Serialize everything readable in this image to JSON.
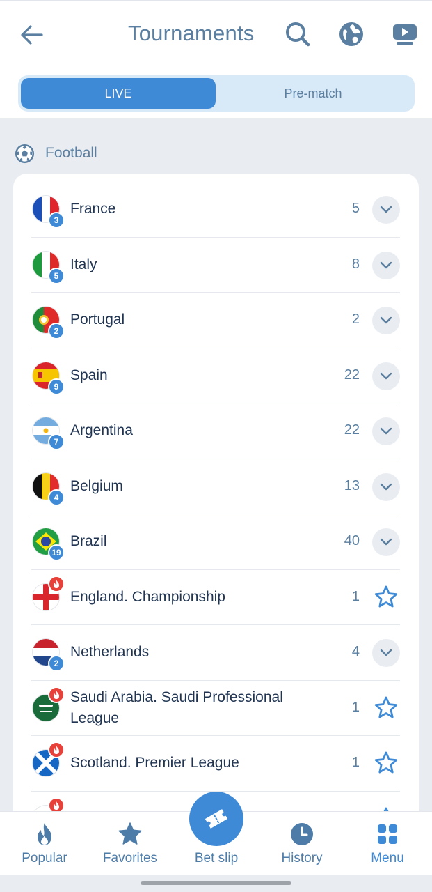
{
  "header": {
    "title": "Tournaments",
    "back_icon": "arrow-left-icon",
    "search_icon": "search-icon",
    "globe_icon": "globe-icon",
    "video_icon": "tv-play-icon"
  },
  "tabs": [
    {
      "label": "LIVE",
      "active": true
    },
    {
      "label": "Pre-match",
      "active": false
    }
  ],
  "section": {
    "icon": "football-icon",
    "label": "Football"
  },
  "tournaments": [
    {
      "name": "France",
      "count": "5",
      "badge": "3",
      "hot": false,
      "action": "expand"
    },
    {
      "name": "Italy",
      "count": "8",
      "badge": "5",
      "hot": false,
      "action": "expand"
    },
    {
      "name": "Portugal",
      "count": "2",
      "badge": "2",
      "hot": false,
      "action": "expand"
    },
    {
      "name": "Spain",
      "count": "22",
      "badge": "9",
      "hot": false,
      "action": "expand"
    },
    {
      "name": "Argentina",
      "count": "22",
      "badge": "7",
      "hot": false,
      "action": "expand"
    },
    {
      "name": "Belgium",
      "count": "13",
      "badge": "4",
      "hot": false,
      "action": "expand"
    },
    {
      "name": "Brazil",
      "count": "40",
      "badge": "19",
      "hot": false,
      "action": "expand"
    },
    {
      "name": "England. Championship",
      "count": "1",
      "badge": "",
      "hot": true,
      "action": "favorite"
    },
    {
      "name": "Netherlands",
      "count": "4",
      "badge": "2",
      "hot": false,
      "action": "expand"
    },
    {
      "name": "Saudi Arabia. Saudi Professional League",
      "count": "1",
      "badge": "",
      "hot": true,
      "action": "favorite"
    },
    {
      "name": "Scotland. Premier League",
      "count": "1",
      "badge": "",
      "hot": true,
      "action": "favorite"
    }
  ],
  "bottom_nav": [
    {
      "label": "Popular",
      "icon": "flame-icon"
    },
    {
      "label": "Favorites",
      "icon": "star-icon"
    },
    {
      "label": "Bet slip",
      "icon": "ticket-icon"
    },
    {
      "label": "History",
      "icon": "clock-icon"
    },
    {
      "label": "Menu",
      "icon": "grid-icon"
    }
  ],
  "colors": {
    "accent": "#3e8ad6",
    "muted_text": "#5b7fa0",
    "text": "#213552",
    "background": "#e9edf2",
    "hot": "#e8413a"
  }
}
